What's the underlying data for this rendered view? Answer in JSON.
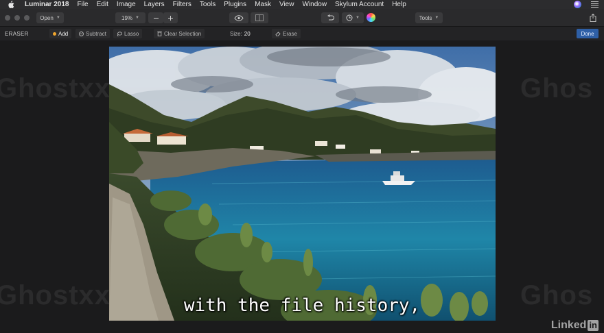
{
  "menubar": {
    "app_name": "Luminar 2018",
    "items": [
      "File",
      "Edit",
      "Image",
      "Layers",
      "Filters",
      "Tools",
      "Plugins",
      "Mask",
      "View",
      "Window",
      "Skylum Account",
      "Help"
    ]
  },
  "toolbar": {
    "open_label": "Open",
    "zoom_value": "19%",
    "tools_label": "Tools"
  },
  "eraser_bar": {
    "title": "ERASER",
    "add_label": "Add",
    "subtract_label": "Subtract",
    "lasso_label": "Lasso",
    "clear_selection_label": "Clear Selection",
    "size_label": "Size:",
    "size_value": "20",
    "erase_label": "Erase",
    "done_label": "Done"
  },
  "overlay": {
    "caption": "with the file history,",
    "watermark": "Ghostxx.com",
    "watermark_short": "Ghos",
    "brand_text": "Linked",
    "brand_box": "in"
  },
  "colors": {
    "accent_done": "#2e5fa6",
    "add_dot": "#f0a62e",
    "background": "#1b1b1c"
  },
  "icons": [
    "apple-logo-icon",
    "siri-icon",
    "menu-list-icon",
    "eye-icon",
    "compare-icon",
    "undo-icon",
    "history-clock-icon",
    "color-wheel-icon",
    "share-icon"
  ]
}
